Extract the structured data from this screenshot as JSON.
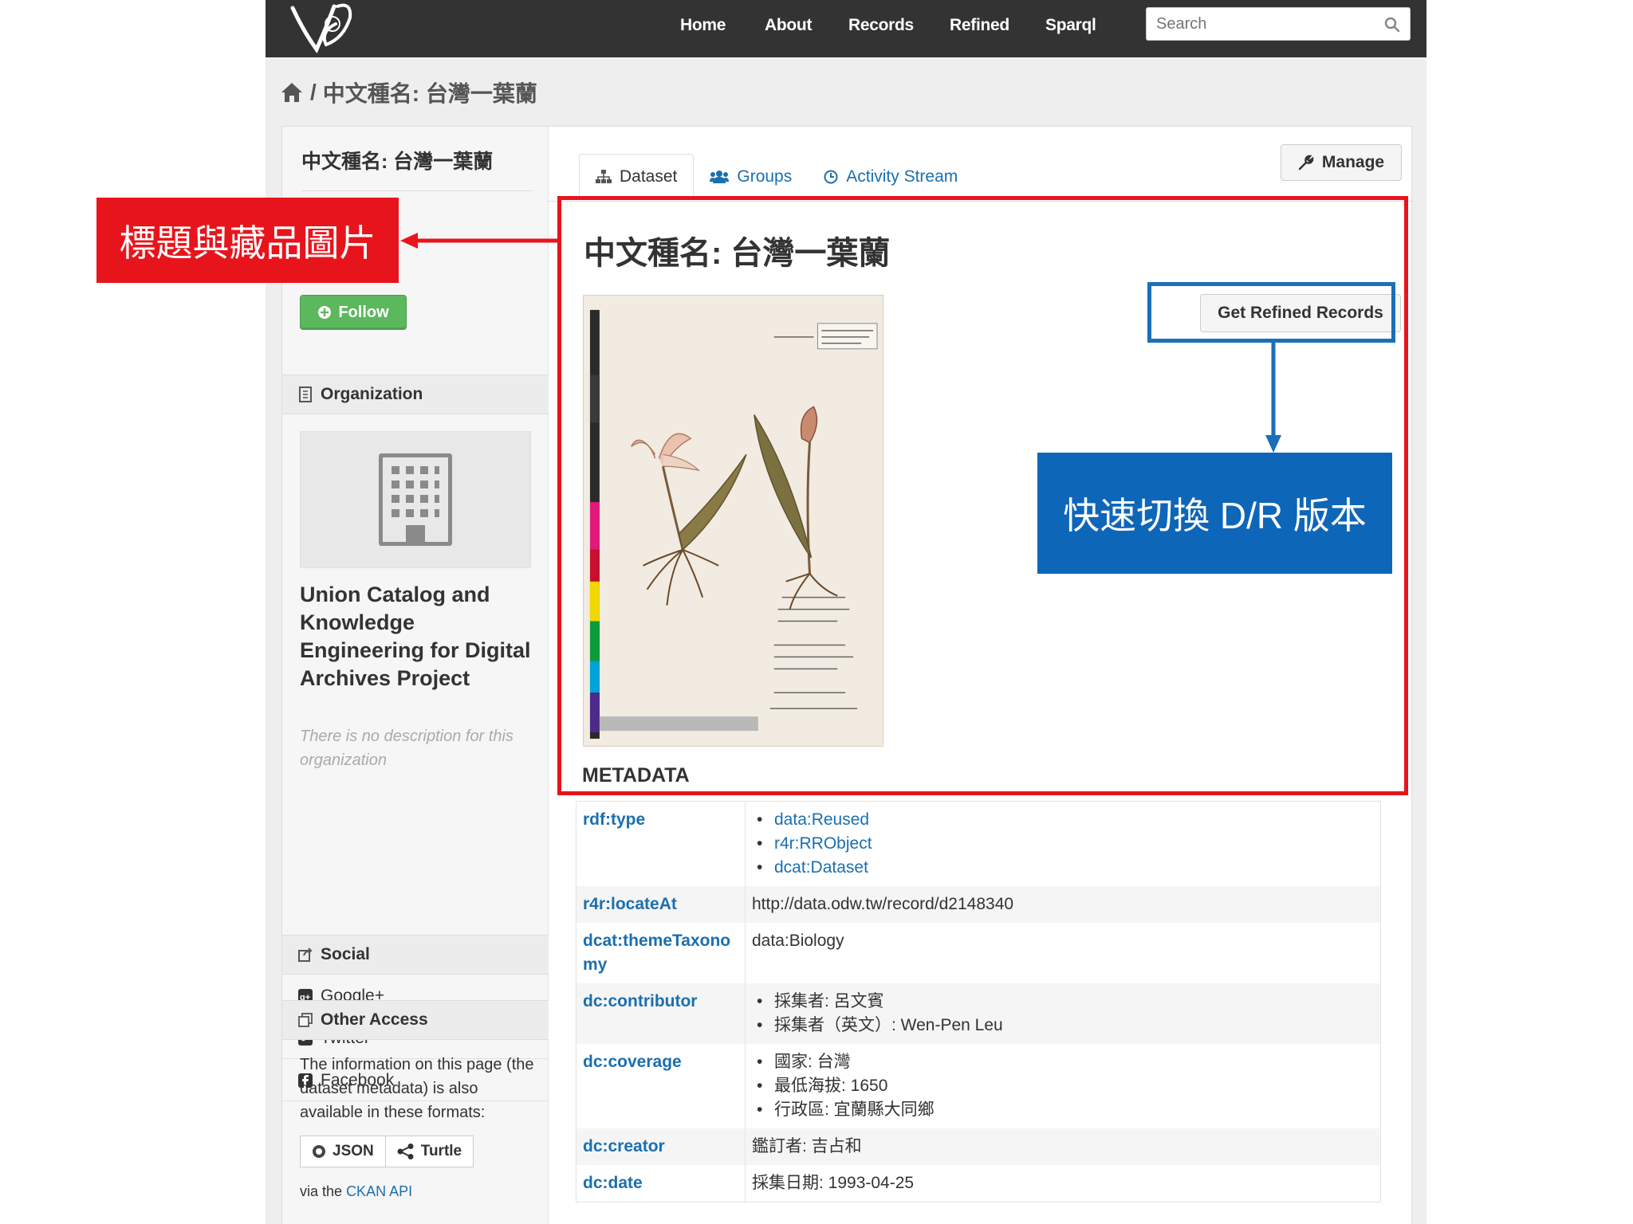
{
  "nav": {
    "links": [
      "Home",
      "About",
      "Records",
      "Refined",
      "Sparql"
    ],
    "search_placeholder": "Search"
  },
  "breadcrumb": {
    "current": "中文種名: 台灣一葉蘭"
  },
  "sidebar": {
    "title": "中文種名: 台灣一葉蘭",
    "follow_label": "Follow",
    "organization_heading": "Organization",
    "org_name": "Union Catalog and Knowledge Engineering for Digital Archives Project",
    "org_description": "There is no description for this organization",
    "social_heading": "Social",
    "social_items": [
      "Google+",
      "Twitter",
      "Facebook"
    ],
    "other_access_heading": "Other Access",
    "other_access_text": "The information on this page (the dataset metadata) is also available in these formats:",
    "formats": [
      "JSON",
      "Turtle"
    ],
    "via_prefix": "via the",
    "api_link": "CKAN API"
  },
  "tabs": [
    "Dataset",
    "Groups",
    "Activity Stream"
  ],
  "manage_label": "Manage",
  "main": {
    "title": "中文種名: 台灣一葉蘭",
    "refined_button": "Get Refined Records",
    "metadata_heading": "METADATA"
  },
  "metadata": [
    {
      "key": "rdf:type",
      "values": [
        "data:Reused",
        "r4r:RRObject",
        "dcat:Dataset"
      ]
    },
    {
      "key": "r4r:locateAt",
      "value": "http://data.odw.tw/record/d2148340"
    },
    {
      "key": "dcat:themeTaxonomy",
      "value": "data:Biology"
    },
    {
      "key": "dc:contributor",
      "values": [
        "採集者: 呂文賓",
        "採集者（英文）: Wen-Pen Leu"
      ]
    },
    {
      "key": "dc:coverage",
      "values": [
        "國家: 台灣",
        "最低海拔: 1650",
        "行政區: 宜蘭縣大同鄉"
      ]
    },
    {
      "key": "dc:creator",
      "value": "鑑訂者: 吉占和"
    },
    {
      "key": "dc:date",
      "value": "採集日期: 1993-04-25"
    }
  ],
  "annotations": {
    "red_label": "標題與藏品圖片",
    "blue_label": "快速切換 D/R 版本"
  },
  "colors": {
    "navbar": "#333333",
    "link": "#1a6fb0",
    "follow_green": "#5cb85c",
    "annotation_red": "#e8141c",
    "annotation_blue": "#0e66b8"
  }
}
